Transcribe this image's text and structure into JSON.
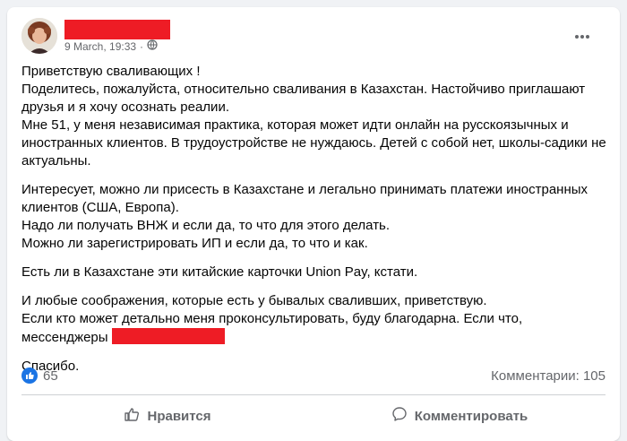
{
  "post": {
    "timestamp": "9 March, 19:33",
    "meta_separator": "·",
    "audience_icon": "globe-icon",
    "more_icon": "more-horizontal-icon",
    "paragraphs": [
      [
        "Приветствую сваливающих !",
        "Поделитесь, пожалуйста, относительно сваливания в Казахстан. Настойчиво приглашают",
        "друзья и я хочу осознать реалии.",
        "Мне 51, у меня независимая практика, которая может идти онлайн на русскоязычных и",
        "иностранных клиентов. В трудоустройстве не нуждаюсь. Детей с собой нет, школы-садики не",
        "актуальны."
      ],
      [
        "Интересует, можно ли присесть в Казахстане и легально принимать платежи иностранных",
        "клиентов (США, Европа).",
        "Надо ли получать ВНЖ и если да, то что для этого делать.",
        "Можно ли зарегистрировать ИП и если да, то что и как."
      ],
      [
        "Есть ли в Казахстане эти китайские карточки Union Pay, кстати."
      ],
      [
        "И любые соображения, которые есть у бывалых сваливших, приветствую.",
        "Если кто может детально меня проконсультировать, буду благодарна. Если что,"
      ]
    ],
    "messengers_label": "мессенджеры",
    "closing": "Спасибо."
  },
  "stats": {
    "reaction_icon": "like-icon",
    "reaction_count": "65",
    "comments": "Комментарии: 105"
  },
  "actions": {
    "like_label": "Нравится",
    "comment_label": "Комментировать"
  },
  "colors": {
    "accent": "#1b74e4",
    "redaction": "#ee1c25",
    "secondary_text": "#65676b"
  }
}
